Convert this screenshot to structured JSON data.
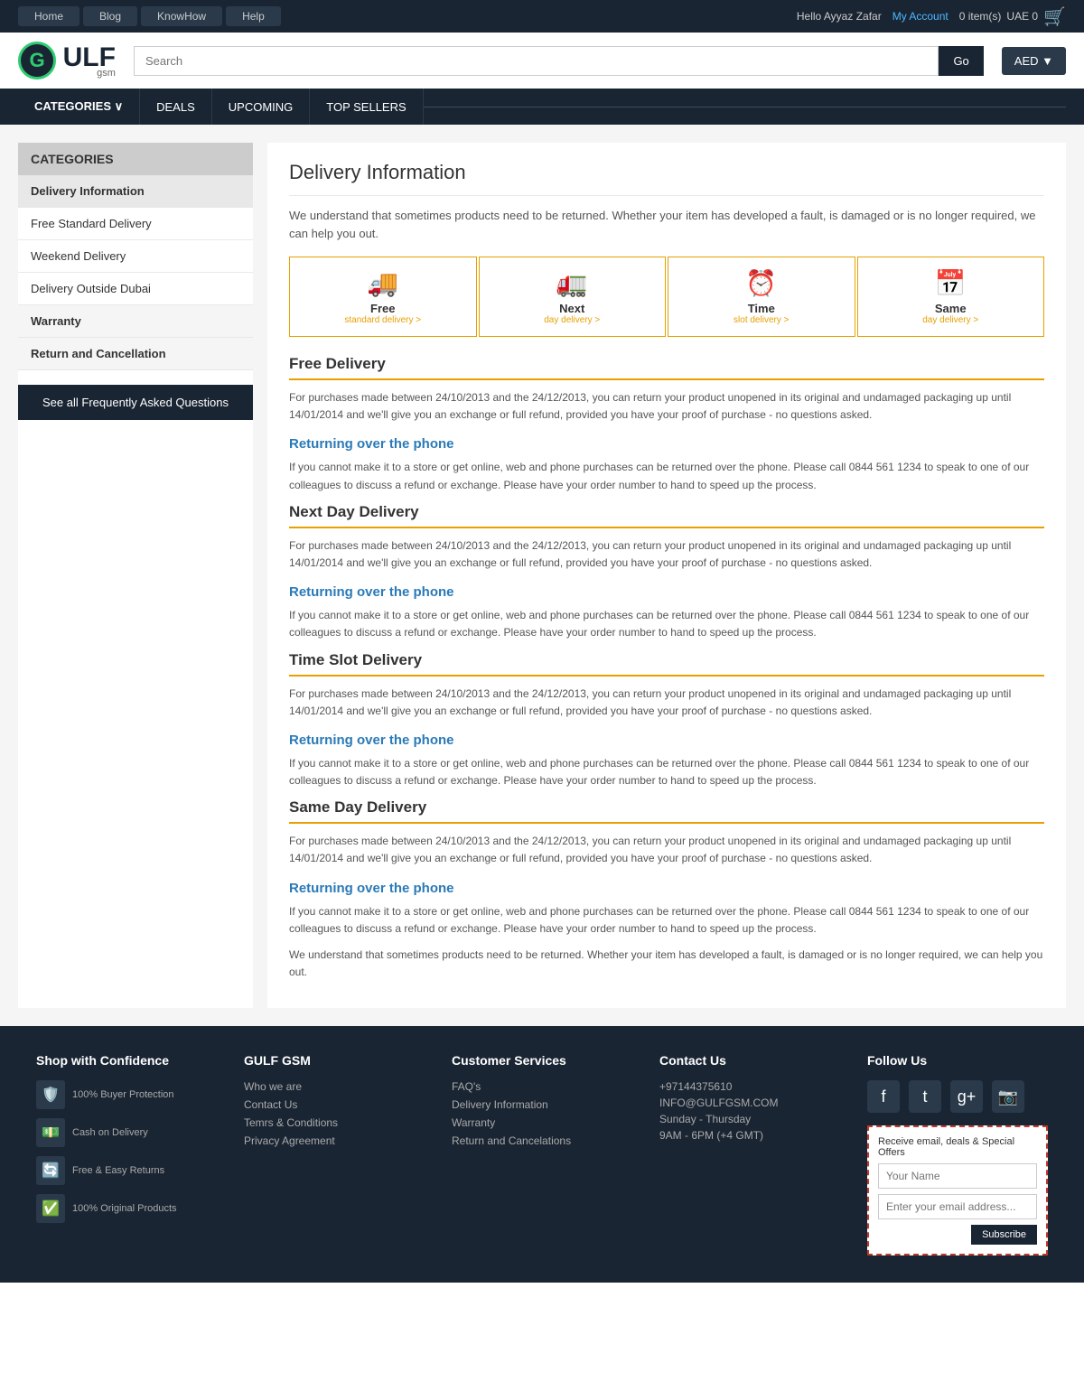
{
  "topbar": {
    "nav": [
      "Home",
      "Blog",
      "KnowHow",
      "Help"
    ],
    "greeting": "Hello Ayyaz Zafar",
    "account_label": "My Account",
    "cart": "0 item(s)",
    "currency": "UAE 0"
  },
  "header": {
    "logo_letter": "G",
    "logo_main": "ULF",
    "logo_sub": "gsm",
    "search_placeholder": "Search",
    "search_btn": "Go",
    "currency_btn": "AED ▼"
  },
  "navbar": {
    "items": [
      "CATEGORIES ∨",
      "DEALS",
      "UPCOMING",
      "TOP SELLERS"
    ]
  },
  "sidebar": {
    "title": "CATEGORIES",
    "active": "Delivery Information",
    "items": [
      "Free Standard Delivery",
      "Weekend Delivery",
      "Delivery Outside Dubai"
    ],
    "sections": [
      "Warranty",
      "Return and Cancellation"
    ],
    "faq_btn": "See all Frequently Asked Questions"
  },
  "content": {
    "title": "Delivery Information",
    "intro": "We understand that sometimes products need to be returned. Whether your item has developed a fault, is damaged or is no longer required, we can help you out.",
    "delivery_icons": [
      {
        "icon": "🚚",
        "label": "Free",
        "sub": "standard delivery >"
      },
      {
        "icon": "🚛",
        "label": "Next",
        "sub": "day delivery >"
      },
      {
        "icon": "⏰",
        "label": "Time",
        "sub": "slot delivery >"
      },
      {
        "icon": "📅",
        "label": "Same",
        "sub": "day delivery >"
      }
    ],
    "sections": [
      {
        "title": "Free Delivery",
        "text": "For purchases made between 24/10/2013 and the 24/12/2013, you can return your product unopened in its original and undamaged packaging up until 14/01/2014 and we'll give you an exchange or full refund, provided you have your proof of purchase - no questions asked.",
        "sub_title": "Returning over the phone",
        "sub_text": "If you cannot make it to a store or get online, web and phone purchases can be returned over the phone. Please call 0844 561 1234 to speak to one of our colleagues to discuss a refund or exchange. Please have your order number to hand to speed up the process."
      },
      {
        "title": "Next Day Delivery",
        "text": "For purchases made between 24/10/2013 and the 24/12/2013, you can return your product unopened in its original and undamaged packaging up until 14/01/2014 and we'll give you an exchange or full refund, provided you have your proof of purchase - no questions asked.",
        "sub_title": "Returning over the phone",
        "sub_text": "If you cannot make it to a store or get online, web and phone purchases can be returned over the phone. Please call 0844 561 1234 to speak to one of our colleagues to discuss a refund or exchange. Please have your order number to hand to speed up the process."
      },
      {
        "title": "Time Slot Delivery",
        "text": "For purchases made between 24/10/2013 and the 24/12/2013, you can return your product unopened in its original and undamaged packaging up until 14/01/2014 and we'll give you an exchange or full refund, provided you have your proof of purchase - no questions asked.",
        "sub_title": "Returning over the phone",
        "sub_text": "If you cannot make it to a store or get online, web and phone purchases can be returned over the phone. Please call 0844 561 1234 to speak to one of our colleagues to discuss a refund or exchange. Please have your order number to hand to speed up the process."
      },
      {
        "title": "Same Day Delivery",
        "text": "For purchases made between 24/10/2013 and the 24/12/2013, you can return your product unopened in its original and undamaged packaging up until 14/01/2014 and we'll give you an exchange or full refund, provided you have your proof of purchase - no questions asked.",
        "sub_title": "Returning over the phone",
        "sub_text": "If you cannot make it to a store or get online, web and phone purchases can be returned over the phone. Please call 0844 561 1234 to speak to one of our colleagues to discuss a refund or exchange. Please have your order number to hand to speed up the process."
      }
    ],
    "outro": "We understand that sometimes products need to be returned. Whether your item has developed a fault, is damaged or is no longer required, we can help you out."
  },
  "footer": {
    "col1": {
      "title": "Shop with Confidence",
      "badges": [
        {
          "icon": "🛡️",
          "label": "100% Buyer Protection"
        },
        {
          "icon": "💵",
          "label": "Cash on Delivery"
        },
        {
          "icon": "🔄",
          "label": "Free & Easy Returns"
        },
        {
          "icon": "✅",
          "label": "100% Original Products"
        }
      ]
    },
    "col2": {
      "title": "GULF GSM",
      "links": [
        "Who we are",
        "Contact Us",
        "Temrs & Conditions",
        "Privacy Agreement"
      ]
    },
    "col3": {
      "title": "Customer Services",
      "links": [
        "FAQ's",
        "Delivery Information",
        "Warranty",
        "Return and Cancelations"
      ]
    },
    "col4": {
      "title": "Contact Us",
      "phone": "+97144375610",
      "email": "INFO@GULFGSM.COM",
      "hours": "Sunday - Thursday",
      "time": "9AM - 6PM (+4 GMT)"
    },
    "col5": {
      "title": "Follow Us",
      "social": [
        "f",
        "t",
        "g+",
        "📷"
      ],
      "newsletter_title": "Receive email, deals & Special Offers",
      "name_placeholder": "Your Name",
      "email_placeholder": "Enter your email address...",
      "subscribe_btn": "Subscribe"
    }
  }
}
